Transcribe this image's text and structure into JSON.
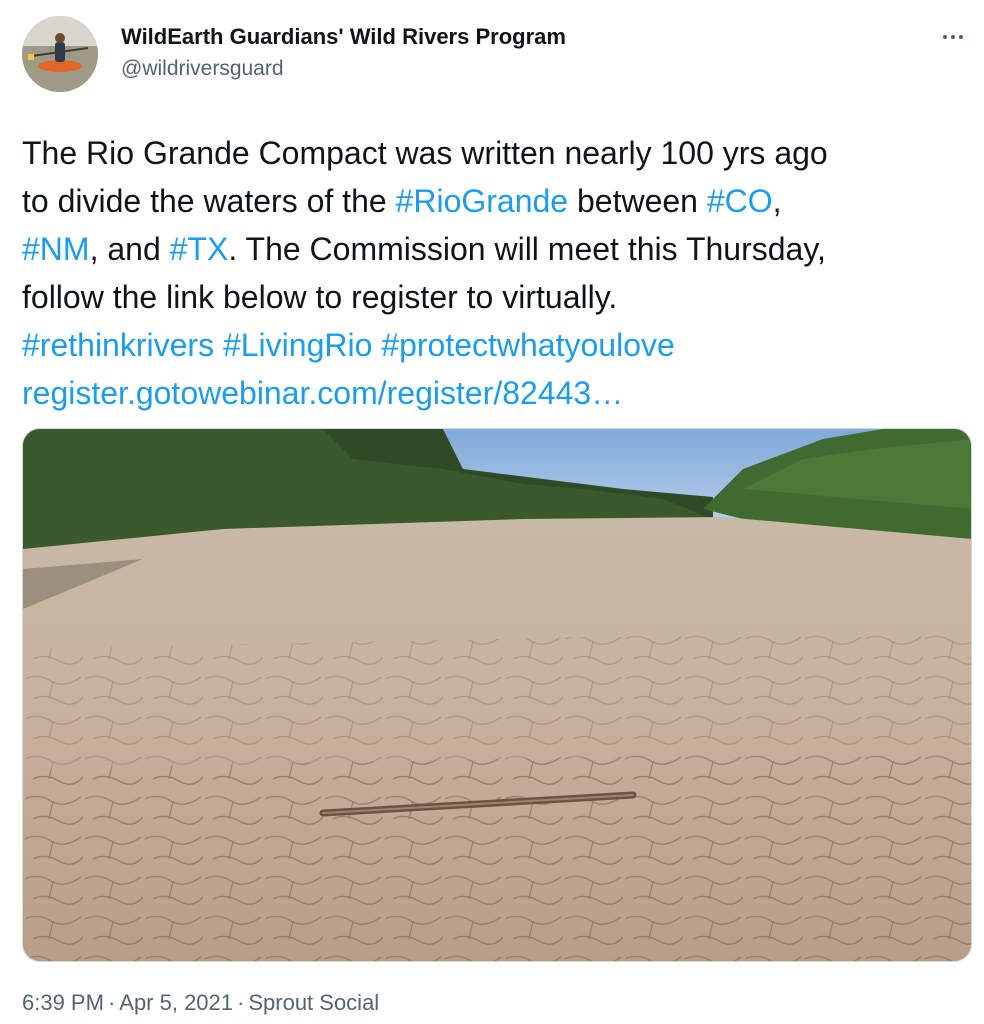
{
  "author": {
    "display_name": "WildEarth Guardians' Wild Rivers Program",
    "handle": "@wildriversguard",
    "avatar_icon": "kayaker-avatar"
  },
  "more_icon": "more-horizontal-icon",
  "tweet": {
    "line1": "The Rio Grande Compact was written nearly 100 yrs ago",
    "line2_a": "to divide the waters of the ",
    "hashtag_riogrande": "#RioGrande",
    "line2_b": " between ",
    "hashtag_co": "#CO",
    "line2_c": ",",
    "hashtag_nm": "#NM",
    "line3_a": ", and ",
    "hashtag_tx": "#TX",
    "line3_b": ". The Commission will meet this Thursday,",
    "line4": "follow the link below to register to virtually.",
    "hashtag_rethinkrivers": "#rethinkrivers",
    "hashtag_livingrio": "#LivingRio",
    "hashtag_protect": "#protectwhatyoulove",
    "link": "register.gotowebinar.com/register/82443…"
  },
  "media": {
    "description_icon": "dry-riverbed-photo"
  },
  "meta": {
    "time": "6:39 PM",
    "separator": "·",
    "date": "Apr 5, 2021",
    "source": "Sprout Social"
  },
  "colors": {
    "link": "#1d9bf0",
    "text": "#0f1419",
    "secondary": "#536471"
  }
}
